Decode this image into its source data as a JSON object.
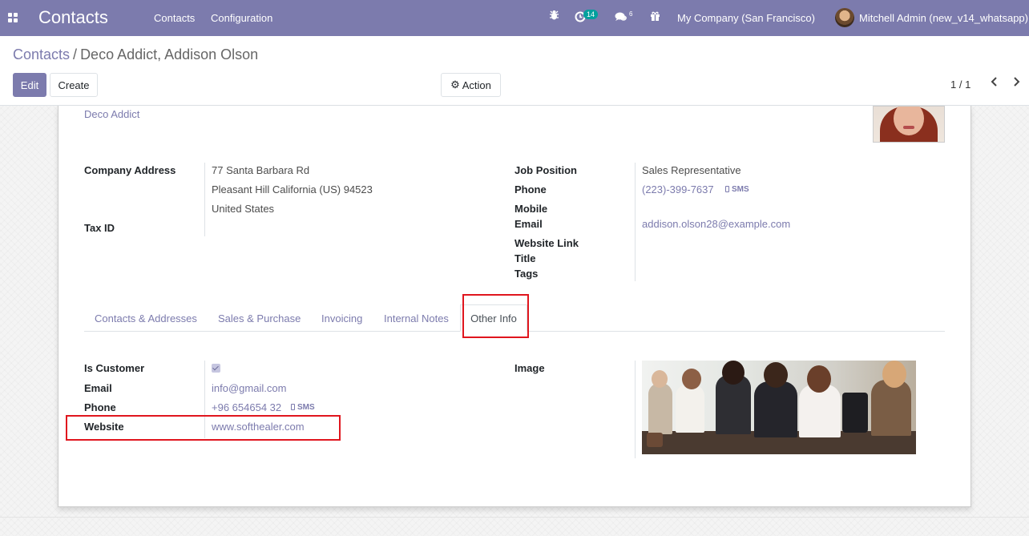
{
  "navbar": {
    "app_title": "Contacts",
    "menu": [
      "Contacts",
      "Configuration"
    ],
    "activity_count": "14",
    "message_count": "6",
    "company": "My Company (San Francisco)",
    "user": "Mitchell Admin (new_v14_whatsapp)",
    "icons": [
      "apps-icon",
      "bug-icon",
      "activity-clock-icon",
      "chat-icon",
      "gift-icon"
    ]
  },
  "breadcrumb": {
    "parent": "Contacts",
    "separator": "/",
    "current": "Deco Addict, Addison Olson"
  },
  "buttons": {
    "edit": "Edit",
    "create": "Create",
    "action": "Action"
  },
  "pager": {
    "value": "1 / 1"
  },
  "contact": {
    "company_link": "Deco Addict",
    "company_address_label": "Company Address",
    "address_line1": "77 Santa Barbara Rd",
    "address_line2": "Pleasant Hill  California (US)  94523",
    "address_line3": "United States",
    "tax_id_label": "Tax ID",
    "job_position_label": "Job Position",
    "job_position": "Sales Representative",
    "phone_label": "Phone",
    "phone": "(223)-399-7637",
    "sms_label": "SMS",
    "mobile_label": "Mobile",
    "email_label": "Email",
    "email": "addison.olson28@example.com",
    "website_link_label": "Website Link",
    "title_label": "Title",
    "tags_label": "Tags"
  },
  "tabs": [
    "Contacts & Addresses",
    "Sales & Purchase",
    "Invoicing",
    "Internal Notes",
    "Other Info"
  ],
  "active_tab": "Other Info",
  "other_info": {
    "is_customer_label": "Is Customer",
    "is_customer": true,
    "email_label": "Email",
    "email": "info@gmail.com",
    "phone_label": "Phone",
    "phone": "+96 654654 32",
    "sms_label": "SMS",
    "website_label": "Website",
    "website": "www.softhealer.com",
    "image_label": "Image"
  },
  "colors": {
    "navbar": "#7c7bad",
    "link": "#7c7bad",
    "highlight": "#e0161e",
    "badge": "#00a09d"
  }
}
